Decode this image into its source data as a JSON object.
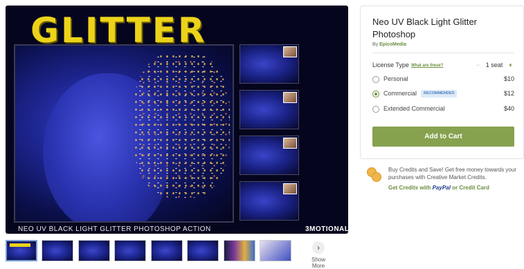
{
  "hero": {
    "title": "GLITTER",
    "caption": "NEO UV BLACK LIGHT GLITTER PHOTOSHOP ACTION",
    "brand": "3MOTIONAL"
  },
  "gallery": {
    "thumb_count": 8,
    "show_more_label": "Show More",
    "show_more_icon": "chevron-right-icon"
  },
  "product": {
    "title": "Neo UV Black Light Glitter Photoshop",
    "by_prefix": "By",
    "author": "EpicoMedia",
    "license_label": "License Type",
    "license_help": "What are these?",
    "seats": "1 seat",
    "seat_minus": "−",
    "seat_plus": "+",
    "options": [
      {
        "name": "Personal",
        "price": "$10",
        "selected": false
      },
      {
        "name": "Commercial",
        "price": "$12",
        "selected": true,
        "badge": "RECOMMENDED"
      },
      {
        "name": "Extended Commercial",
        "price": "$40",
        "selected": false
      }
    ],
    "cart_label": "Add to Cart",
    "accent_color": "#86a24f"
  },
  "credits": {
    "text": "Buy Credits and Save! Get free money towards your purchases with Creative Market Credits.",
    "link_prefix": "Get Credits with",
    "paypal": "PayPal",
    "link_suffix": "or Credit Card"
  }
}
